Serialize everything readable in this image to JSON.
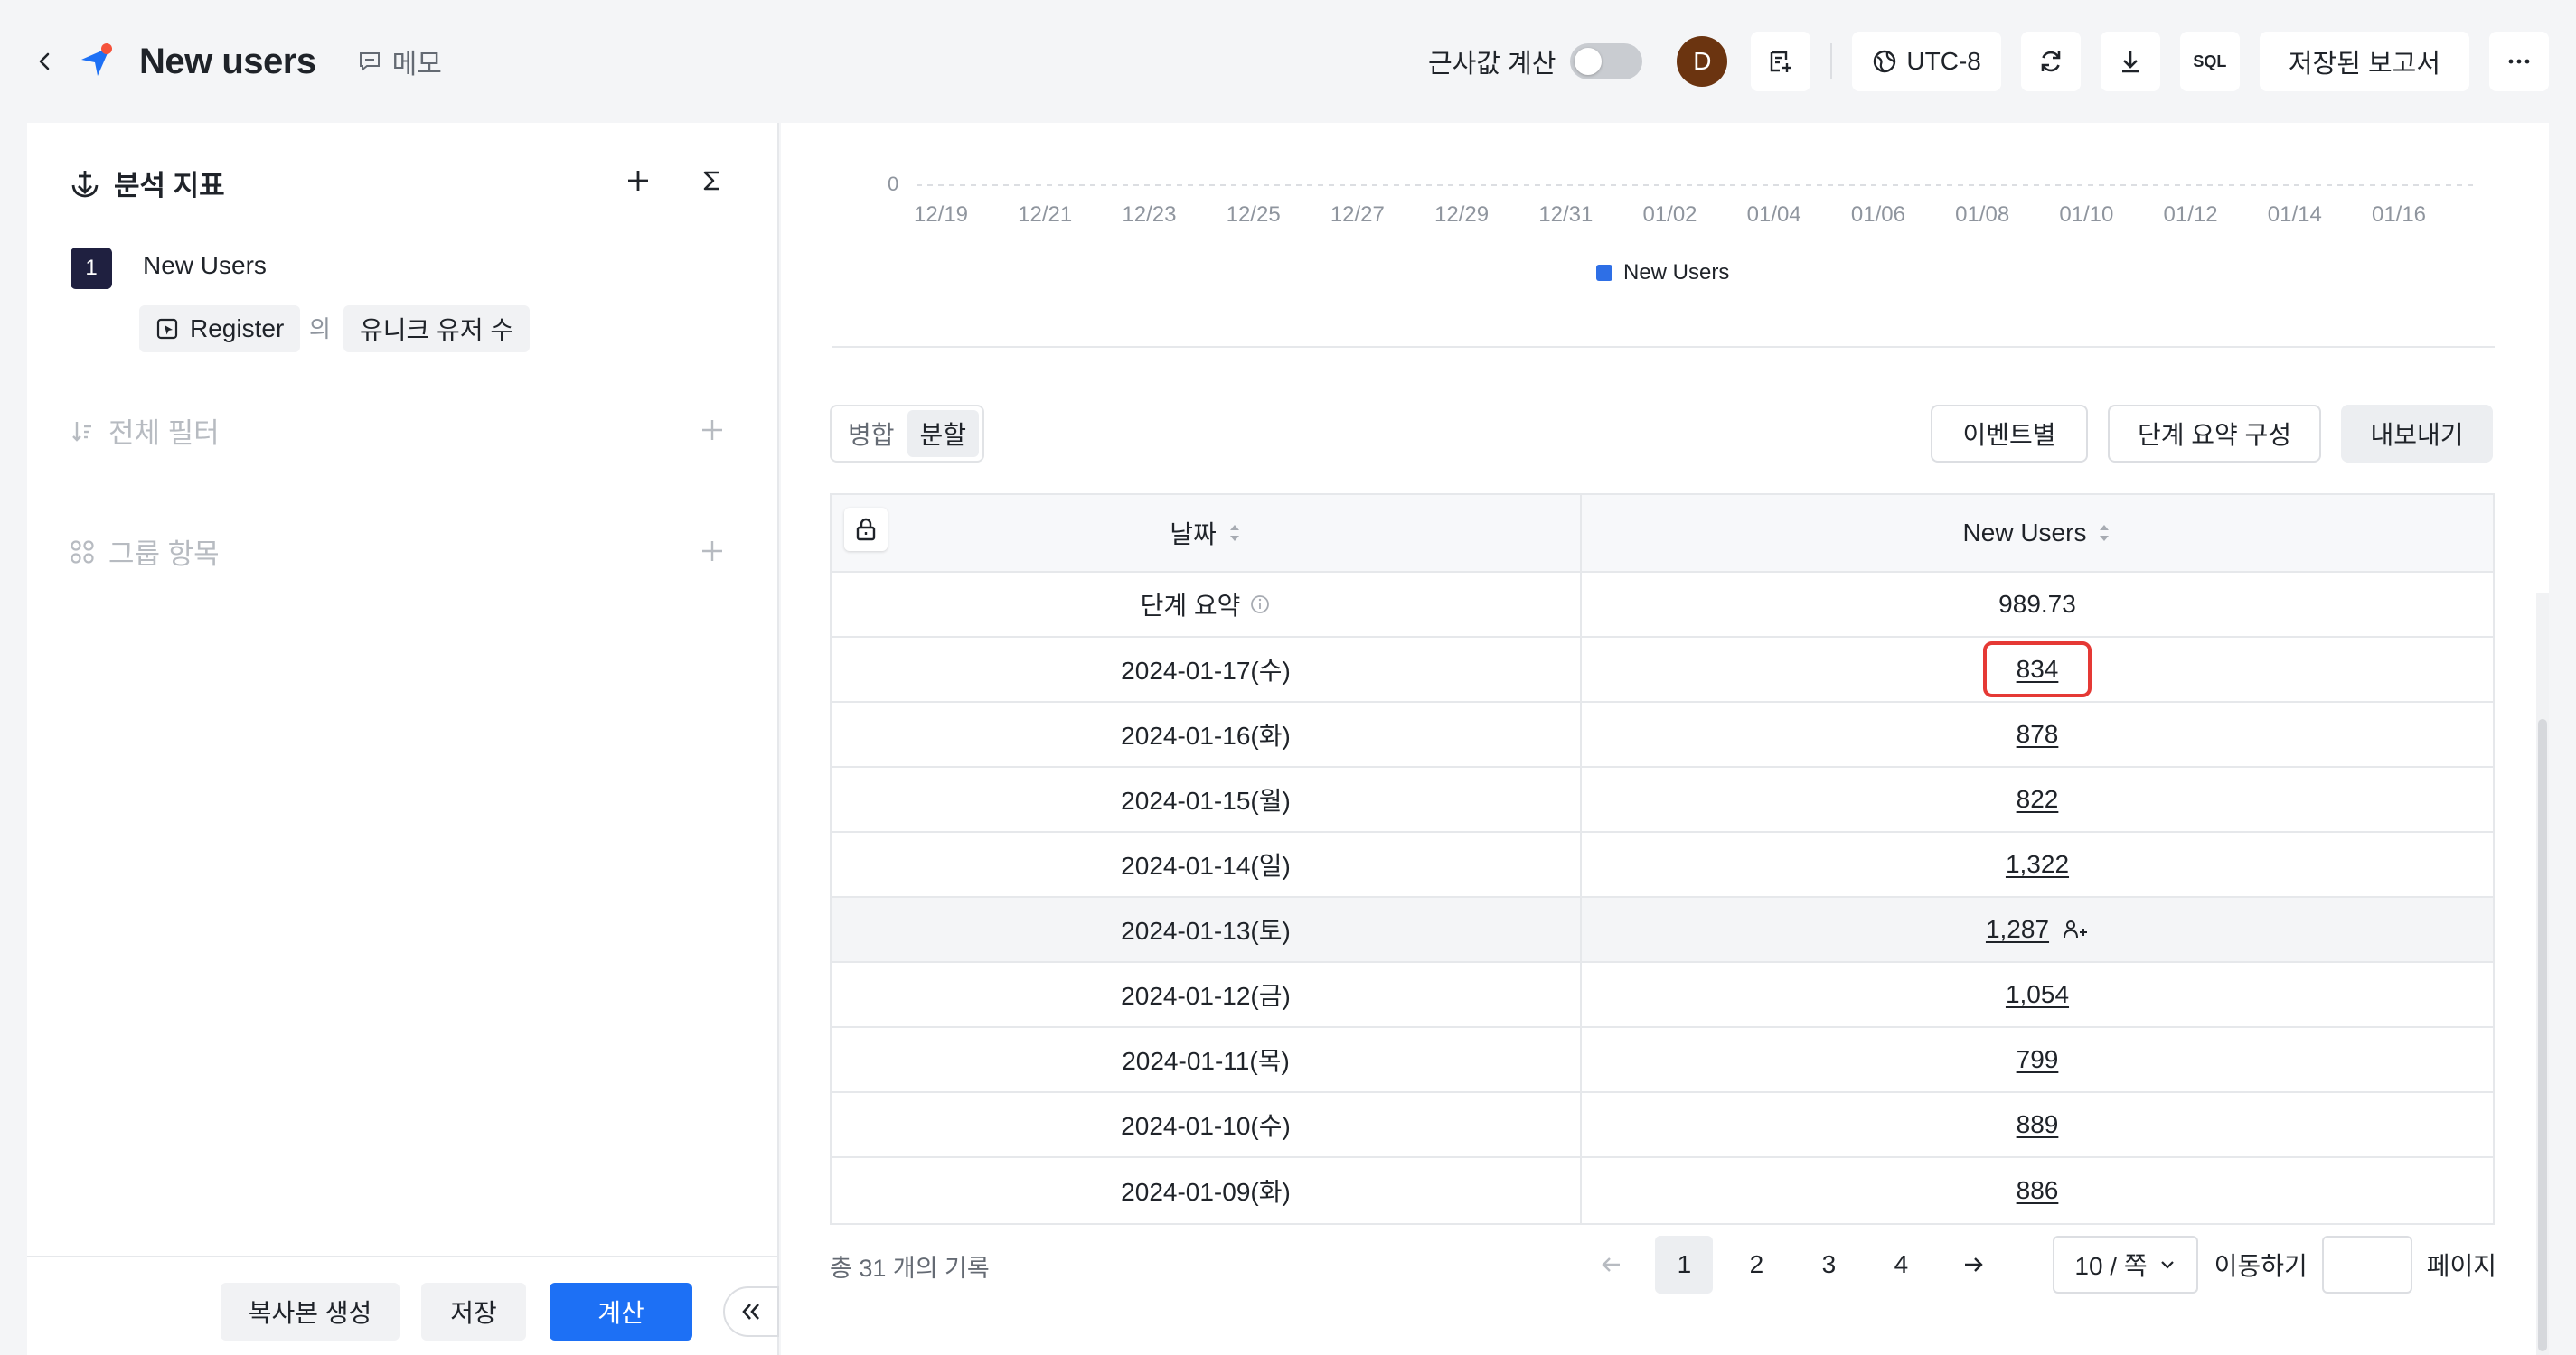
{
  "header": {
    "title": "New users",
    "memo_label": "메모",
    "approx_label": "근사값 계산",
    "avatar_initial": "D",
    "timezone": "UTC-8",
    "sql_label": "SQL",
    "saved_reports_label": "저장된 보고서"
  },
  "sidebar": {
    "metrics_title": "분석 지표",
    "metric": {
      "index": "1",
      "name": "New Users",
      "event": "Register",
      "of": "의",
      "measure": "유니크 유저 수"
    },
    "filter_title": "전체 필터",
    "group_title": "그룹 항목",
    "footer": {
      "copy": "복사본 생성",
      "save": "저장",
      "calculate": "계산"
    }
  },
  "chart": {
    "y_zero": "0",
    "x_ticks": [
      "12/19",
      "12/21",
      "12/23",
      "12/25",
      "12/27",
      "12/29",
      "12/31",
      "01/02",
      "01/04",
      "01/06",
      "01/08",
      "01/10",
      "01/12",
      "01/14",
      "01/16"
    ],
    "legend": "New Users",
    "series_color": "#2e6fe6"
  },
  "toolbar": {
    "merge": "병합",
    "split": "분할",
    "by_event": "이벤트별",
    "summary_config": "단계 요약 구성",
    "export": "내보내기"
  },
  "table": {
    "col_date": "날짜",
    "col_value": "New Users",
    "summary_label": "단계 요약",
    "summary_value": "989.73",
    "rows": [
      {
        "date": "2024-01-17(수)",
        "value": "834"
      },
      {
        "date": "2024-01-16(화)",
        "value": "878"
      },
      {
        "date": "2024-01-15(월)",
        "value": "822"
      },
      {
        "date": "2024-01-14(일)",
        "value": "1,322"
      },
      {
        "date": "2024-01-13(토)",
        "value": "1,287"
      },
      {
        "date": "2024-01-12(금)",
        "value": "1,054"
      },
      {
        "date": "2024-01-11(목)",
        "value": "799"
      },
      {
        "date": "2024-01-10(수)",
        "value": "889"
      },
      {
        "date": "2024-01-09(화)",
        "value": "886"
      }
    ]
  },
  "pagination": {
    "total": "총 31 개의 기록",
    "pages": [
      "1",
      "2",
      "3",
      "4"
    ],
    "current": "1",
    "page_size": "10 / 쪽",
    "goto": "이동하기",
    "page_suffix": "페이지"
  },
  "colors": {
    "primary": "#1d70f5",
    "highlight": "#e53935"
  }
}
